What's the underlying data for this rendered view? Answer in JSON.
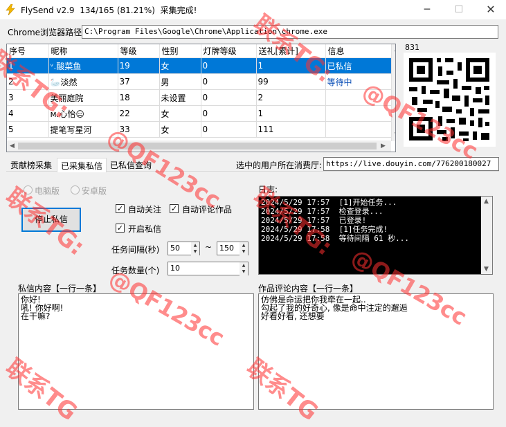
{
  "window": {
    "title": "FlySend v2.9  134/165 (81.21%)  采集完成!",
    "min": "─",
    "max": "☐",
    "close": "✕"
  },
  "chrome_path": {
    "label": "Chrome浏览器路径:",
    "value": "C:\\Program Files\\Google\\Chrome\\Application\\chrome.exe"
  },
  "grid": {
    "columns": [
      "序号",
      "昵称",
      "等级",
      "性别",
      "灯牌等级",
      "送礼[累计]",
      "信息"
    ],
    "rows": [
      [
        "1",
        "ᵛ.酸菜鱼",
        "19",
        "女",
        "0",
        "1",
        "已私信"
      ],
      [
        "2",
        "🦢淡然",
        "37",
        "男",
        "0",
        "99",
        "等待中"
      ],
      [
        "3",
        "美丽庭院",
        "18",
        "未设置",
        "0",
        "2",
        ""
      ],
      [
        "4",
        "ᴍ.心怡😑",
        "22",
        "女",
        "0",
        "1",
        ""
      ],
      [
        "5",
        "提笔写星河",
        "33",
        "女",
        "0",
        "111",
        ""
      ]
    ]
  },
  "qr": {
    "label": "831"
  },
  "tabs": [
    "贡献榜采集",
    "已采集私信",
    "已私信查询"
  ],
  "location": {
    "label": "选中的用户所在消费厅:",
    "value": "https://live.douyin.com/776200180027"
  },
  "mode": {
    "pc": "电脑版",
    "android": "安卓版"
  },
  "stop_button": "停止私信",
  "options": {
    "auto_follow": "自动关注",
    "auto_comment": "自动评论作品",
    "enable_dm": "开启私信"
  },
  "interval": {
    "label": "任务间隔(秒)",
    "from": "50",
    "sep": "~",
    "to": "150"
  },
  "count": {
    "label": "任务数量(个)",
    "value": "10"
  },
  "log": {
    "label": "日志:",
    "lines": [
      "2024/5/29 17:57  [1]开始任务...",
      "2024/5/29 17:57  检查登录...",
      "2024/5/29 17:57  已登录!",
      "2024/5/29 17:58  [1]任务完成!",
      "2024/5/29 17:58  等待间隔 61 秒..."
    ]
  },
  "dm_content": {
    "label": "私信内容【一行一条】",
    "text": "你好!\n吼! 你好啊!\n在干嘛?"
  },
  "comment_content": {
    "label": "作品评论内容【一行一条】",
    "text": "仿佛是命运把你我牵在一起..\n勾起了我的好奇心, 像是命中注定的邂逅\n好看好看, 还想要"
  },
  "watermarks": {
    "tg": "联系TG:",
    "tg_short": "联系TG",
    "handle": "@QF123cc"
  },
  "colors": {
    "selection": "#0078d7",
    "watermark": "#ff3030",
    "waiting": "#0047b3"
  }
}
